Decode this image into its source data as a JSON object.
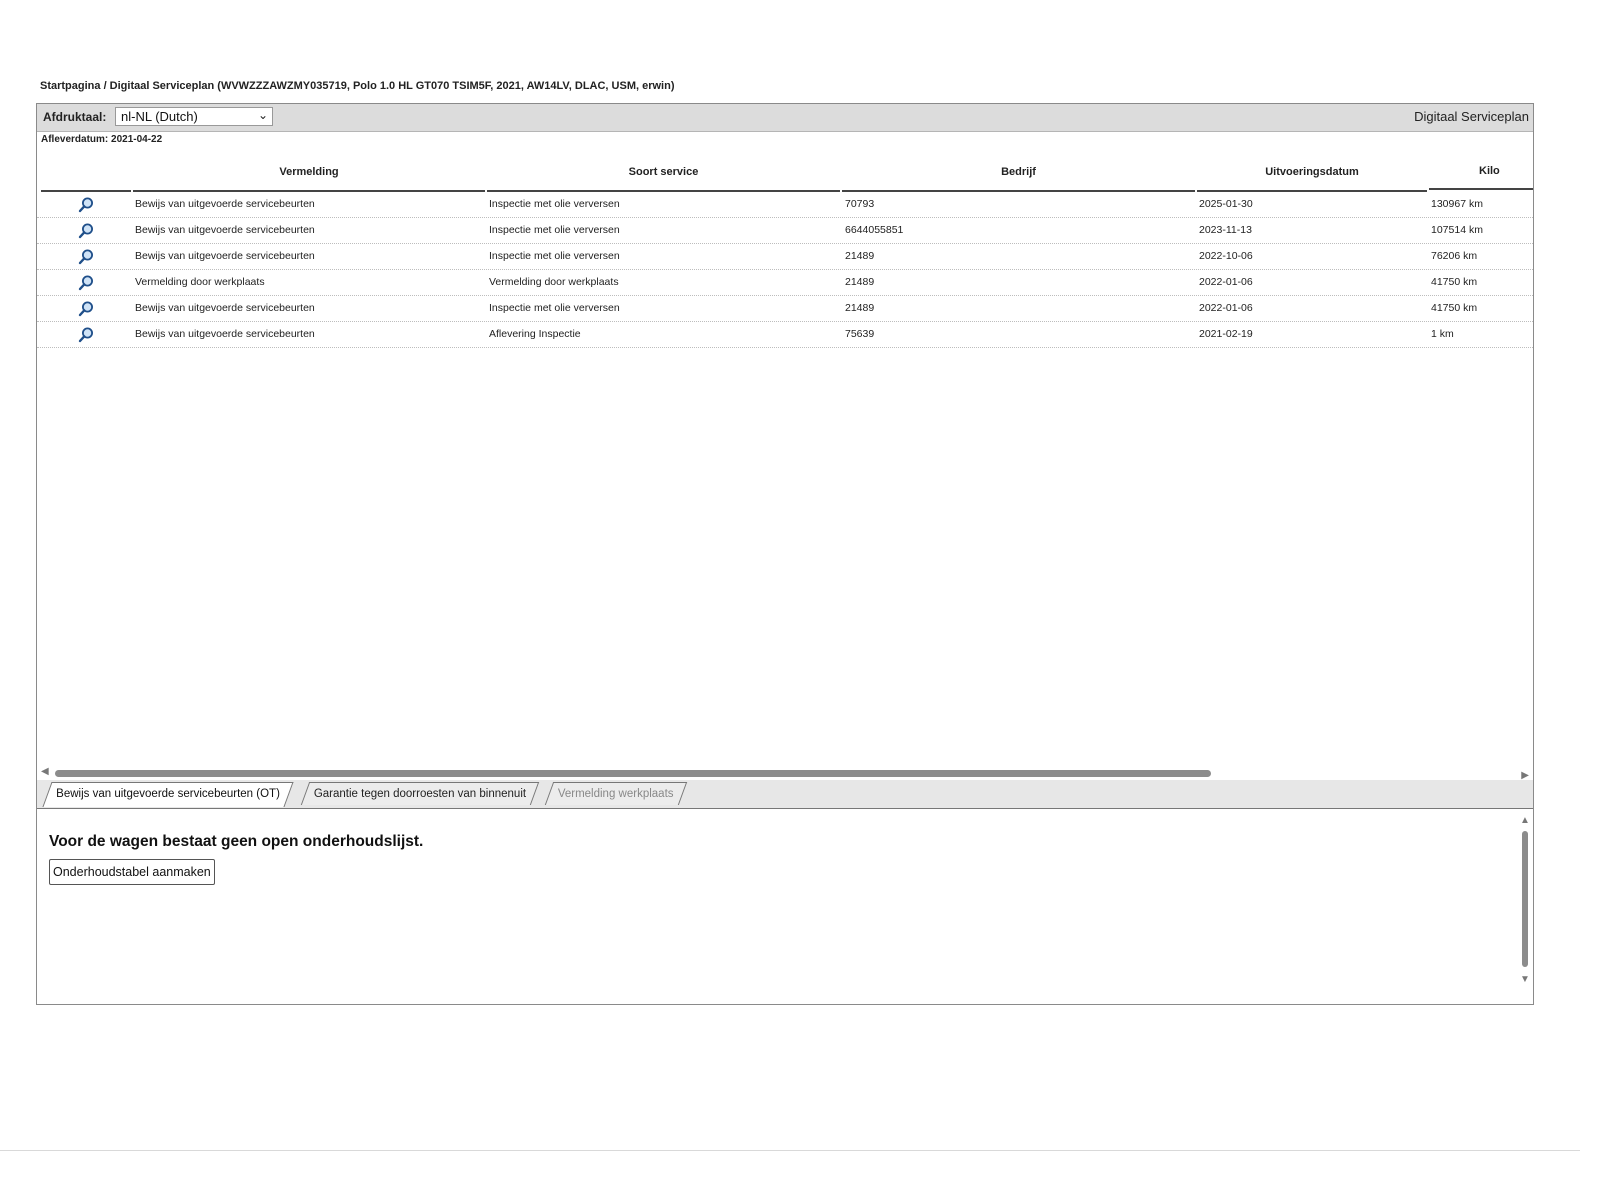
{
  "breadcrumb": "Startpagina / Digitaal Serviceplan (WVWZZZAWZMY035719, Polo 1.0 HL GT070 TSIM5F, 2021, AW14LV, DLAC, USM, erwin)",
  "toolbar": {
    "language_label": "Afdruktaal:",
    "language_value": "nl-NL (Dutch)",
    "plan_title": "Digitaal Serviceplan"
  },
  "delivery_date": "Afleverdatum: 2021-04-22",
  "table": {
    "headers": [
      "Vermelding",
      "Soort service",
      "Bedrijf",
      "Uitvoeringsdatum",
      "Kilo"
    ],
    "rows": [
      {
        "entry": "Bewijs van uitgevoerde servicebeurten",
        "service": "Inspectie met olie verversen",
        "company": "70793",
        "date": "2025-01-30",
        "km": "130967 km"
      },
      {
        "entry": "Bewijs van uitgevoerde servicebeurten",
        "service": "Inspectie met olie verversen",
        "company": "6644055851",
        "date": "2023-11-13",
        "km": "107514 km"
      },
      {
        "entry": "Bewijs van uitgevoerde servicebeurten",
        "service": "Inspectie met olie verversen",
        "company": "21489",
        "date": "2022-10-06",
        "km": "76206 km"
      },
      {
        "entry": "Vermelding door werkplaats",
        "service": "Vermelding door werkplaats",
        "company": "21489",
        "date": "2022-01-06",
        "km": "41750 km"
      },
      {
        "entry": "Bewijs van uitgevoerde servicebeurten",
        "service": "Inspectie met olie verversen",
        "company": "21489",
        "date": "2022-01-06",
        "km": "41750 km"
      },
      {
        "entry": "Bewijs van uitgevoerde servicebeurten",
        "service": "Aflevering Inspectie",
        "company": "75639",
        "date": "2021-02-19",
        "km": "1 km"
      }
    ]
  },
  "tabs": [
    "Bewijs van uitgevoerde servicebeurten (OT)",
    "Garantie tegen doorroesten van binnenuit",
    "Vermelding werkplaats"
  ],
  "lower": {
    "message": "Voor de wagen bestaat geen open onderhoudslijst.",
    "create_button": "Onderhoudstabel aanmaken"
  },
  "icons": {
    "row_icon": "magnifier-icon"
  }
}
